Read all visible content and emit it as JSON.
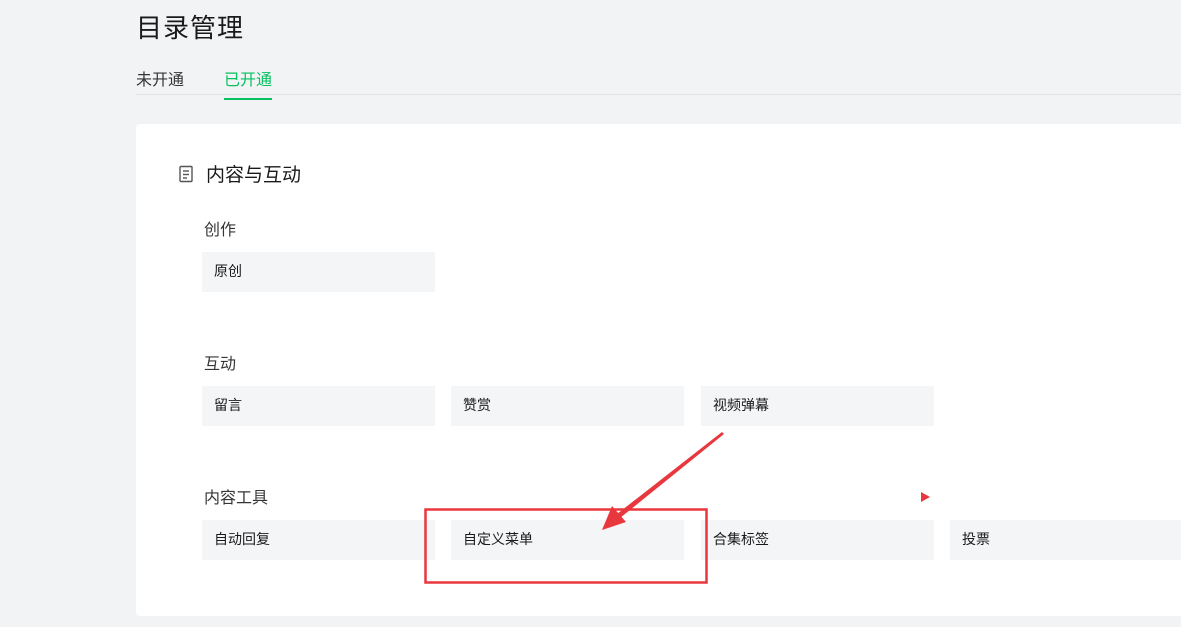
{
  "header": {
    "title": "目录管理",
    "tabs": [
      {
        "label": "未开通",
        "active": false
      },
      {
        "label": "已开通",
        "active": true
      }
    ]
  },
  "section": {
    "icon": "document-icon",
    "title": "内容与互动",
    "groups": [
      {
        "label": "创作",
        "items": [
          "原创"
        ]
      },
      {
        "label": "互动",
        "items": [
          "留言",
          "赞赏",
          "视频弹幕"
        ]
      },
      {
        "label": "内容工具",
        "items": [
          "自动回复",
          "自定义菜单",
          "合集标签",
          "投票"
        ]
      }
    ]
  },
  "colors": {
    "accent": "#07c160",
    "annotation": "#e8373d",
    "tile_bg": "#f4f5f7"
  }
}
